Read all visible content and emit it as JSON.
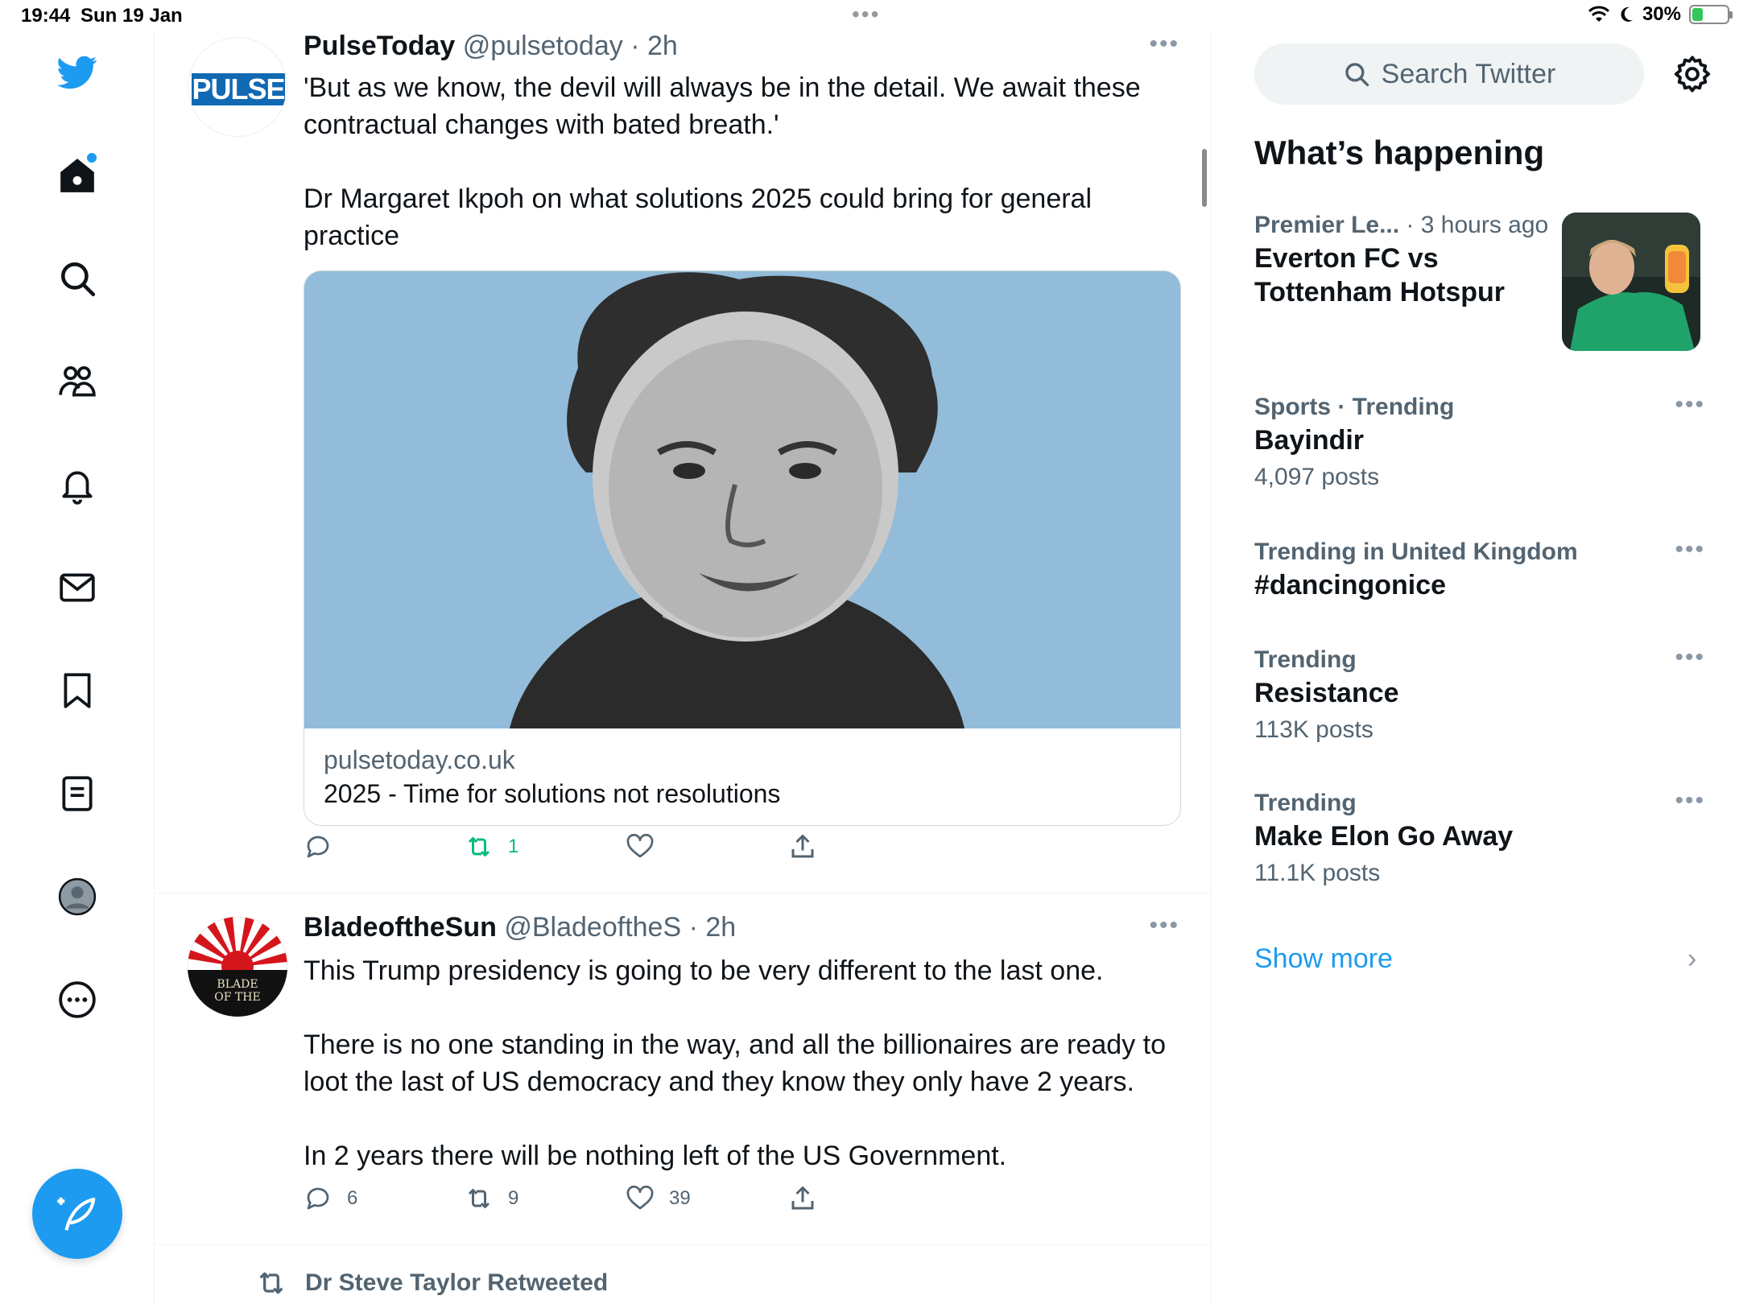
{
  "status_bar": {
    "time": "19:44",
    "date": "Sun 19 Jan",
    "battery": "30%",
    "battery_level": 0.3
  },
  "colors": {
    "accent": "#1d9bf0",
    "retweet": "#00ba7c",
    "secondary_text": "#536471"
  },
  "nav": {
    "items": [
      "twitter-logo",
      "home-icon",
      "search-icon",
      "communities-icon",
      "notifications-icon",
      "messages-icon",
      "bookmarks-icon",
      "lists-icon",
      "profile-icon",
      "more-icon"
    ],
    "compose_icon": "compose-feather-icon"
  },
  "timeline": {
    "tweets": [
      {
        "name": "PulseToday",
        "handle": "@pulsetoday",
        "time": "· 2h",
        "avatar_text": "PULSE",
        "text": [
          "'But as we know, the devil will always be in the detail. We await these contractual changes with bated breath.'",
          "Dr Margaret Ikpoh on what solutions 2025 could bring for general practice"
        ],
        "card": {
          "domain": "pulsetoday.co.uk",
          "title": "2025 - Time for solutions not resolutions"
        },
        "actions": {
          "replies": "",
          "retweets": "1",
          "likes": "",
          "share": ""
        }
      },
      {
        "name": "BladeoftheSun",
        "handle": "@BladeoftheS",
        "time": "· 2h",
        "avatar_text": "BLADE OF THE",
        "text": [
          "This Trump presidency is going to be very different to the last one.",
          "There is no one standing in the way, and all the billionaires are ready to loot the last of US democracy and they know they only have 2 years.",
          "In 2 years there will be nothing left of the US Government."
        ],
        "actions": {
          "replies": "6",
          "retweets": "9",
          "likes": "39",
          "share": ""
        }
      }
    ],
    "retweeted_by": "Dr Steve Taylor Retweeted"
  },
  "sidebar": {
    "search_placeholder": "Search Twitter",
    "section_title": "What’s happening",
    "trends": [
      {
        "context": "Premier Le...",
        "context_suffix": " · 3 hours ago",
        "topic_line1": "Everton FC vs",
        "topic_line2": "Tottenham Hotspur",
        "count": ""
      },
      {
        "context": "Sports · Trending",
        "topic": "Bayindir",
        "count": "4,097 posts"
      },
      {
        "context": "Trending in United Kingdom",
        "topic": "#dancingonice",
        "count": ""
      },
      {
        "context": "Trending",
        "topic": "Resistance",
        "count": "113K posts"
      },
      {
        "context": "Trending",
        "topic": "Make Elon Go Away",
        "count": "11.1K posts"
      }
    ],
    "show_more": "Show more"
  }
}
